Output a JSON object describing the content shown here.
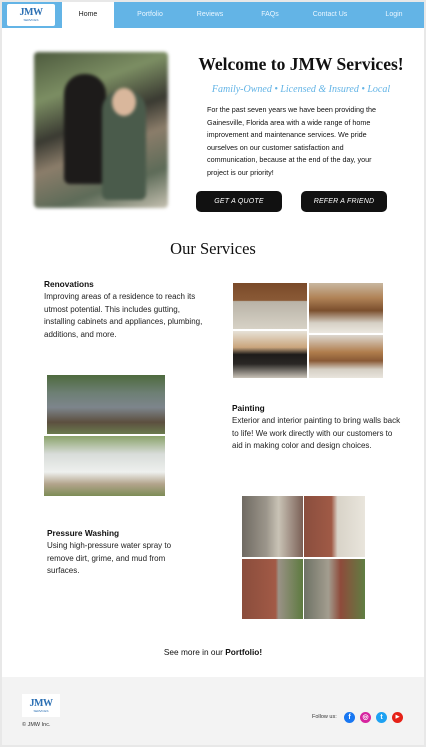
{
  "nav": {
    "logo_text": "JMW",
    "logo_sub": "SERVICES",
    "items": [
      {
        "label": "Home",
        "active": true
      },
      {
        "label": "Portfolio"
      },
      {
        "label": "Reviews"
      },
      {
        "label": "FAQs"
      },
      {
        "label": "Contact Us"
      },
      {
        "label": "Login"
      }
    ]
  },
  "hero": {
    "title": "Welcome to JMW Services!",
    "subtitle": "Family-Owned • Licensed & Insured • Local",
    "body": "For the past seven years we have been providing the Gainesville, Florida area with a wide range of home improvement and maintenance services. We pride ourselves on our customer satisfaction and communication, because at the end of the day, your project is our priority!",
    "quote_button": "GET A QUOTE",
    "refer_button": "REFER A FRIEND"
  },
  "services": {
    "heading": "Our Services",
    "items": [
      {
        "title": "Renovations",
        "description": "Improving areas of a residence to reach its utmost potential. This includes gutting, installing cabinets and appliances, plumbing, additions, and more."
      },
      {
        "title": "Painting",
        "description": "Exterior and interior painting to bring walls back to life! We work directly with our customers to aid in making color and design choices."
      },
      {
        "title": "Pressure Washing",
        "description": "Using high-pressure water spray to remove dirt, grime, and mud from surfaces."
      }
    ]
  },
  "portfolio_prompt": {
    "prefix": "See more in our ",
    "link": "Portfolio!"
  },
  "footer": {
    "logo_text": "JMW",
    "logo_sub": "SERVICES",
    "copyright": "© JMW Inc.",
    "follow_label": "Follow us:",
    "social": [
      {
        "icon": "facebook-icon",
        "color": "#1877f2",
        "glyph": "f"
      },
      {
        "icon": "instagram-icon",
        "color": "#d6249f",
        "glyph": "◎"
      },
      {
        "icon": "twitter-icon",
        "color": "#1da1f2",
        "glyph": "t"
      },
      {
        "icon": "youtube-icon",
        "color": "#e62117",
        "glyph": "▶"
      }
    ]
  },
  "colors": {
    "accent": "#63b4e6",
    "button": "#111111"
  }
}
